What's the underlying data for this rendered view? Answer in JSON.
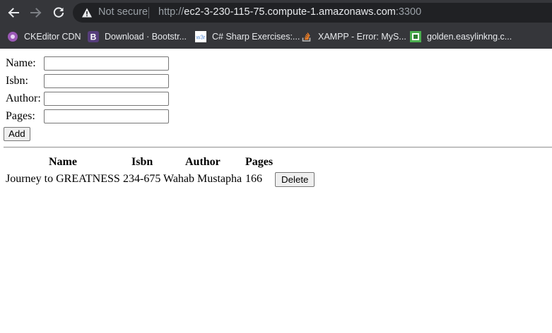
{
  "browser": {
    "security_label": "Not secure",
    "url": {
      "scheme": "http://",
      "host": "ec2-3-230-115-75.compute-1.amazonaws.com",
      "port": ":3300"
    },
    "bookmarks": [
      {
        "label": "CKEditor CDN",
        "icon": "ckeditor-icon"
      },
      {
        "label": "Download · Bootstr...",
        "icon": "bootstrap-icon"
      },
      {
        "label": "C# Sharp Exercises:...",
        "icon": "w3resource-icon"
      },
      {
        "label": "XAMPP - Error: MyS...",
        "icon": "stackoverflow-icon"
      },
      {
        "label": "golden.easylinkng.c...",
        "icon": "site-favicon"
      }
    ]
  },
  "form": {
    "name": {
      "label": "Name:",
      "value": ""
    },
    "isbn": {
      "label": "Isbn:",
      "value": ""
    },
    "author": {
      "label": "Author:",
      "value": ""
    },
    "pages": {
      "label": "Pages:",
      "value": ""
    },
    "add_label": "Add"
  },
  "table": {
    "headers": [
      "Name",
      "Isbn",
      "Author",
      "Pages"
    ],
    "rows": [
      {
        "name": "Journey to GREATNESS",
        "isbn": "234-675",
        "author": "Wahab Mustapha",
        "pages": "166",
        "delete_label": "Delete"
      }
    ]
  },
  "colors": {
    "chrome_bg": "#35363a",
    "omnibox_bg": "#202124",
    "button_bg": "#efefef"
  }
}
